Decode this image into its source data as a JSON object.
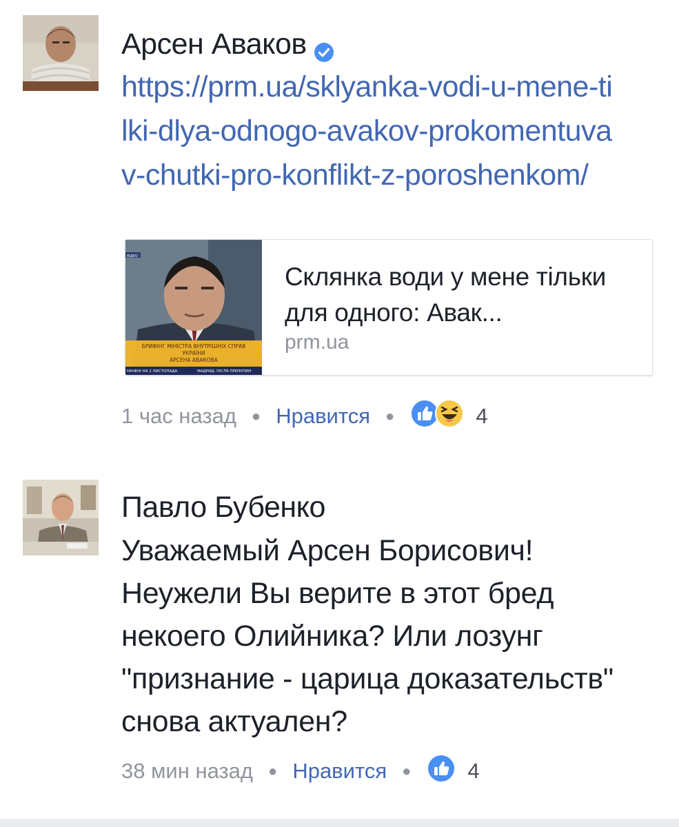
{
  "comments": [
    {
      "author": "Арсен Аваков",
      "verified": true,
      "link": "https://prm.ua/sklyanka-vodi-u-mene-tilki-dlya-odnogo-avakov-prokomentuvav-chutki-pro-konflikt-z-poroshenkom/",
      "preview": {
        "title": "Склянка води у мене тільки для одного: Авак...",
        "domain": "prm.ua",
        "thumb_caption_line1": "БРИФІНГ МІНІСТРА ВНУТРІШНІХ СПРАВ",
        "thumb_caption_line2": "УКРАЇНИ",
        "thumb_caption_line3": "АРСЕНА АВАКОВА",
        "thumb_ticker_left": "НАЧЕНІ НА 2 ЛИСТОПАДА",
        "thumb_ticker_right": "МАДРИД: ПІСЛЯ ПРИЗУПИН",
        "thumb_tag": "ВІДЕО"
      },
      "time": "1 час назад",
      "like_label": "Нравится",
      "reactions": [
        "like-icon",
        "haha-icon"
      ],
      "reaction_count": "4"
    },
    {
      "author": "Павло Бубенко",
      "verified": false,
      "text": "Уважаемый Арсен Борисович! Неужели Вы верите в этот бред некоего Олийника? Или лозунг \"признание - царица доказательств\" снова актуален?",
      "time": "38 мин назад",
      "like_label": "Нравится",
      "reactions": [
        "like-icon"
      ],
      "reaction_count": "4"
    }
  ],
  "colors": {
    "link": "#4267b2",
    "text": "#1d2129",
    "meta": "#90949c",
    "like_blue": "#1877f2",
    "haha_yellow": "#f7c949"
  }
}
